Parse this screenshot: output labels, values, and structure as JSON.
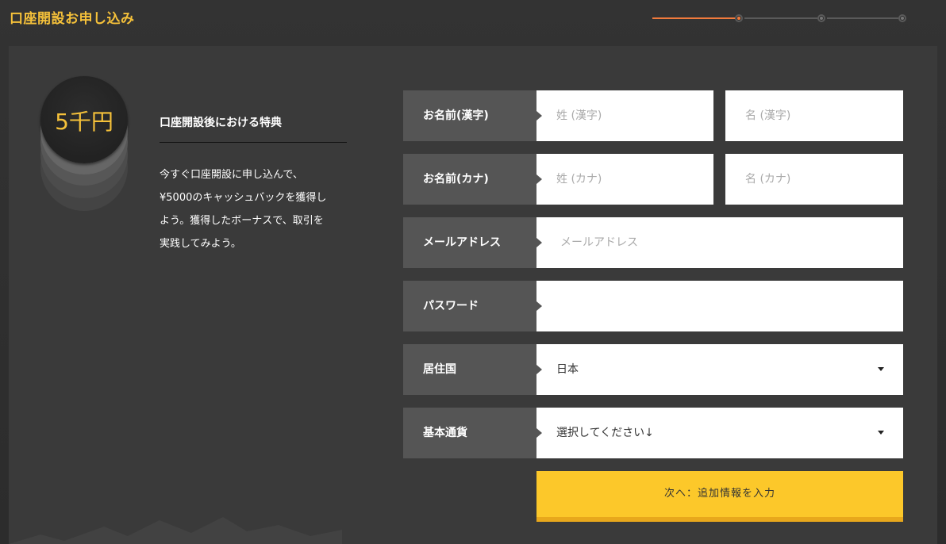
{
  "header": {
    "title": "口座開設お申し込み",
    "steps_total": 3,
    "current_step": 1
  },
  "benefit": {
    "coin_text": "5千円",
    "title": "口座開設後における特典",
    "description": "今すぐ口座開設に申し込んで、¥5000のキャッシュバックを獲得しよう。獲得したボーナスで、取引を実践してみよう。"
  },
  "form": {
    "name_kanji": {
      "label": "お名前(漢字)",
      "last_placeholder": "姓 (漢字)",
      "first_placeholder": "名 (漢字)"
    },
    "name_kana": {
      "label": "お名前(カナ)",
      "last_placeholder": "姓 (カナ)",
      "first_placeholder": "名 (カナ)"
    },
    "email": {
      "label": "メールアドレス",
      "placeholder": "メールアドレス"
    },
    "password": {
      "label": "パスワード",
      "placeholder": ""
    },
    "country": {
      "label": "居住国",
      "value": "日本"
    },
    "currency": {
      "label": "基本通貨",
      "value": "選択してください↓"
    },
    "next_button": "次へ：追加情報を入力"
  },
  "colors": {
    "accent": "#f5c13a",
    "button": "#fcc82a",
    "progress_active": "#f07a3c"
  }
}
